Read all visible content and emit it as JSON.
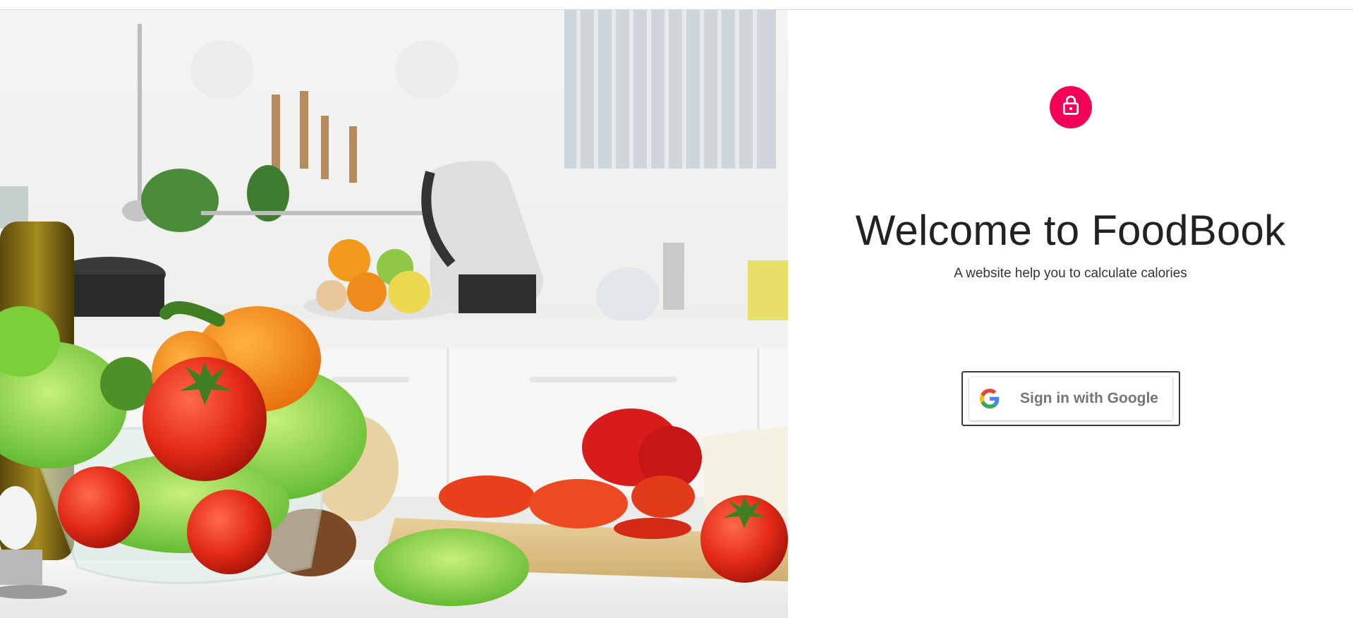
{
  "hero": {
    "image_alt": "Kitchen counter with fresh vegetables: lettuce bowl, tomatoes, peppers, bread, oil bottle"
  },
  "avatar": {
    "icon": "lock-icon",
    "color": "#f50057"
  },
  "welcome": {
    "title": "Welcome to FoodBook",
    "subtitle": "A website help you to calculate calories"
  },
  "google_signin": {
    "label": "Sign in with Google",
    "icon": "google-logo-icon",
    "label_color": "#757575"
  }
}
